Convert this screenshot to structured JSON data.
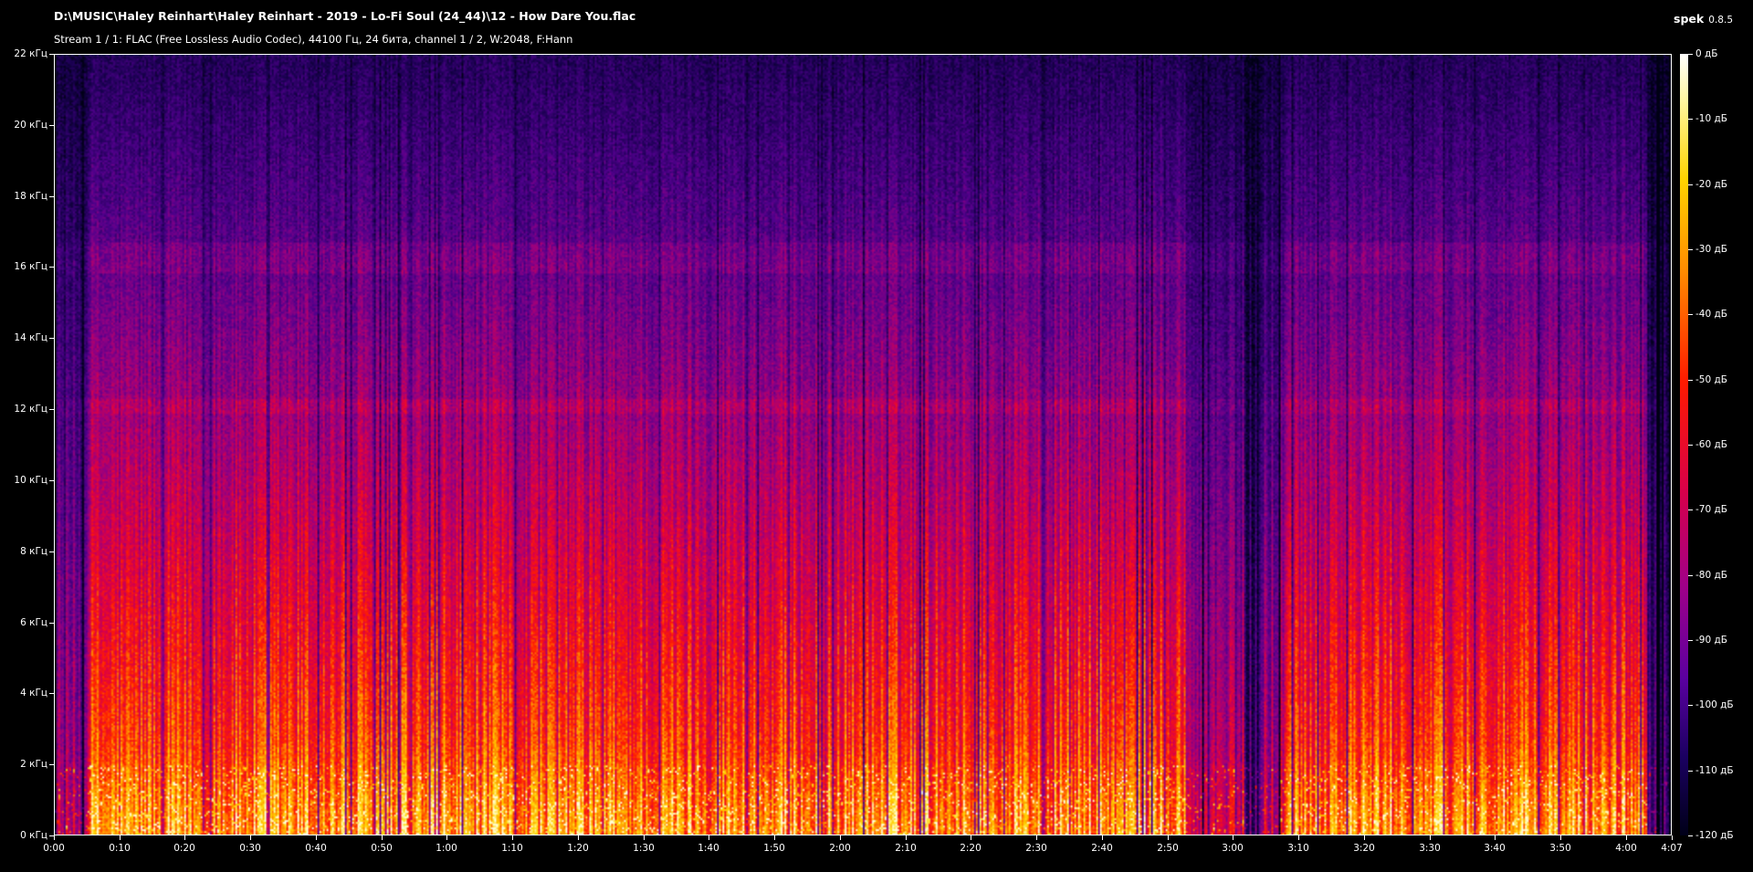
{
  "window": {
    "file_path": "D:\\MUSIC\\Haley Reinhart\\Haley Reinhart - 2019 - Lo-Fi Soul (24_44)\\12 - How Dare You.flac",
    "stream_info": "Stream 1 / 1: FLAC (Free Lossless Audio Codec), 44100 Гц, 24 бита, channel 1 / 2, W:2048, F:Hann",
    "app_name": "spek",
    "app_version": "0.8.5"
  },
  "axes": {
    "frequency_labels": [
      "22 кГц",
      "20 кГц",
      "18 кГц",
      "16 кГц",
      "14 кГц",
      "12 кГц",
      "10 кГц",
      "8 кГц",
      "6 кГц",
      "4 кГц",
      "2 кГц",
      "0 кГц"
    ],
    "time_labels": [
      "0:00",
      "0:10",
      "0:20",
      "0:30",
      "0:40",
      "0:50",
      "1:00",
      "1:10",
      "1:20",
      "1:30",
      "1:40",
      "1:50",
      "2:00",
      "2:10",
      "2:20",
      "2:30",
      "2:40",
      "2:50",
      "3:00",
      "3:10",
      "3:20",
      "3:30",
      "3:40",
      "3:50",
      "4:00",
      "4:07"
    ],
    "db_labels": [
      "0 дБ",
      "-10 дБ",
      "-20 дБ",
      "-30 дБ",
      "-40 дБ",
      "-50 дБ",
      "-60 дБ",
      "-70 дБ",
      "-80 дБ",
      "-90 дБ",
      "-100 дБ",
      "-110 дБ",
      "-120 дБ"
    ]
  },
  "colors": {
    "background": "#000000",
    "foreground": "#ffffff"
  }
}
